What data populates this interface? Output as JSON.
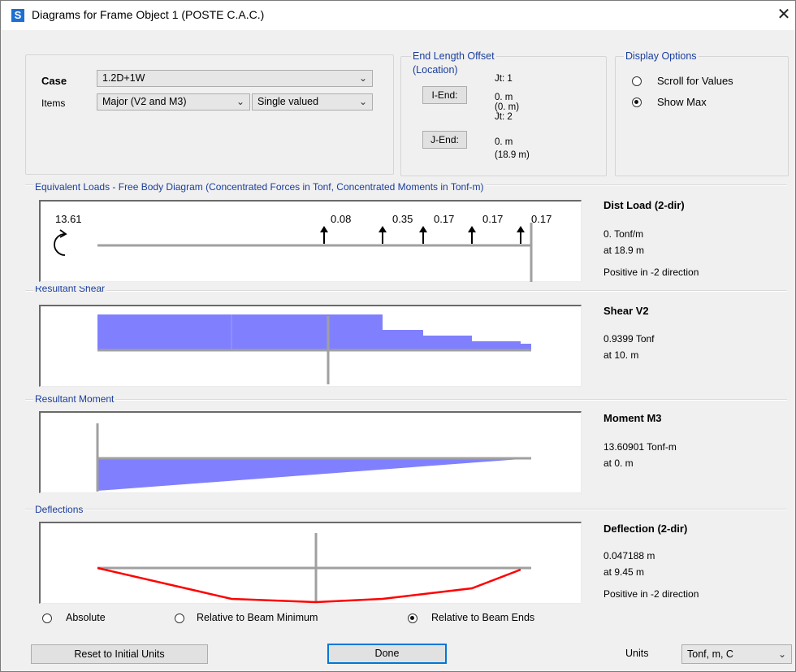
{
  "window": {
    "title": "Diagrams for Frame Object 1  (POSTE C.A.C.)",
    "app_icon_letter": "S",
    "close_glyph": "✕"
  },
  "case_panel": {
    "case_label": "Case",
    "case_value": "1.2D+1W",
    "items_label": "Items",
    "items_value": "Major (V2 and M3)",
    "valued_value": "Single valued"
  },
  "end_offset": {
    "group_label": "End Length Offset",
    "location_label": "(Location)",
    "i_end_button": "I-End:",
    "i_jt": "Jt:  1",
    "i_value": "0. m",
    "i_location": "(0. m)",
    "j_jt": "Jt:  2",
    "j_end_button": "J-End:",
    "j_value": "0. m",
    "j_location": "(18.9 m)"
  },
  "display_options": {
    "group_label": "Display Options",
    "scroll_label": "Scroll for Values",
    "show_max_label": "Show Max",
    "selected": "Show Max"
  },
  "fbd": {
    "group_label": "Equivalent Loads - Free Body Diagram  (Concentrated Forces in Tonf, Concentrated Moments in Tonf-m)",
    "moment_label": "13.61",
    "force_labels": [
      "0.08",
      "0.35",
      "0.17",
      "0.17",
      "0.17"
    ],
    "info_title": "Dist Load (2-dir)",
    "info_value": "0. Tonf/m",
    "info_at": "at 18.9 m",
    "info_note": "Positive in -2 direction"
  },
  "shear": {
    "group_label": "Resultant Shear",
    "info_title": "Shear V2",
    "info_value": "0.9399 Tonf",
    "info_at": "at 10. m"
  },
  "moment": {
    "group_label": "Resultant Moment",
    "info_title": "Moment M3",
    "info_value": "13.60901 Tonf-m",
    "info_at": "at 0. m"
  },
  "deflection": {
    "group_label": "Deflections",
    "info_title": "Deflection (2-dir)",
    "info_value": "0.047188 m",
    "info_at": "at 9.45 m",
    "info_note": "Positive in -2 direction",
    "radio_absolute": "Absolute",
    "radio_rel_min": "Relative to Beam Minimum",
    "radio_rel_ends": "Relative to Beam Ends",
    "selected": "Relative to Beam Ends"
  },
  "footer": {
    "reset_label": "Reset to Initial Units",
    "done_label": "Done",
    "units_label": "Units",
    "units_value": "Tonf, m, C"
  },
  "colors": {
    "diagram_fill": "#8080ff",
    "deflected_shape": "#ff0000",
    "group_label_text": "#1b3e9c",
    "axis_gray": "#a0a0a0"
  }
}
